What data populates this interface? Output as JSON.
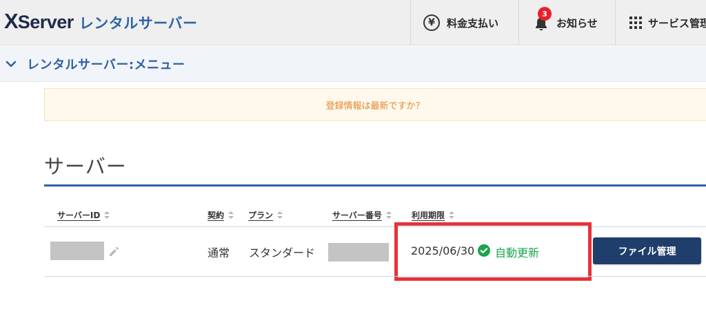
{
  "header": {
    "logo_x": "X",
    "logo_server": "Server",
    "logo_sub": "レンタルサーバー",
    "nav": {
      "payment_label": "料金支払い",
      "payment_icon": "yen-icon",
      "notice_label": "お知らせ",
      "notice_icon": "bell-icon",
      "notice_count": "3",
      "services_label": "サービス管理",
      "services_icon": "grid-icon"
    }
  },
  "menubar": {
    "title": "レンタルサーバー:メニュー",
    "icon": "chevron-down-icon"
  },
  "notice": {
    "text": "登録情報は最新ですか？"
  },
  "section": {
    "title": "サーバー"
  },
  "table": {
    "headers": {
      "server_id": "サーバーID",
      "contract": "契約",
      "plan": "プラン",
      "server_number": "サーバー番号",
      "expiry": "利用期限"
    },
    "rows": [
      {
        "contract": "通常",
        "plan": "スタンダード",
        "expiry_date": "2025/06/30",
        "renewal_status": "自動更新",
        "action_label": "ファイル管理"
      }
    ]
  },
  "colors": {
    "brand_navy": "#1e2b4a",
    "brand_blue": "#2f5fa3",
    "button": "#1f3e6b",
    "status_green": "#1aa44b",
    "highlight_red": "#e6323a",
    "notice_orange": "#e3872c",
    "badge_red": "#e8202a"
  }
}
